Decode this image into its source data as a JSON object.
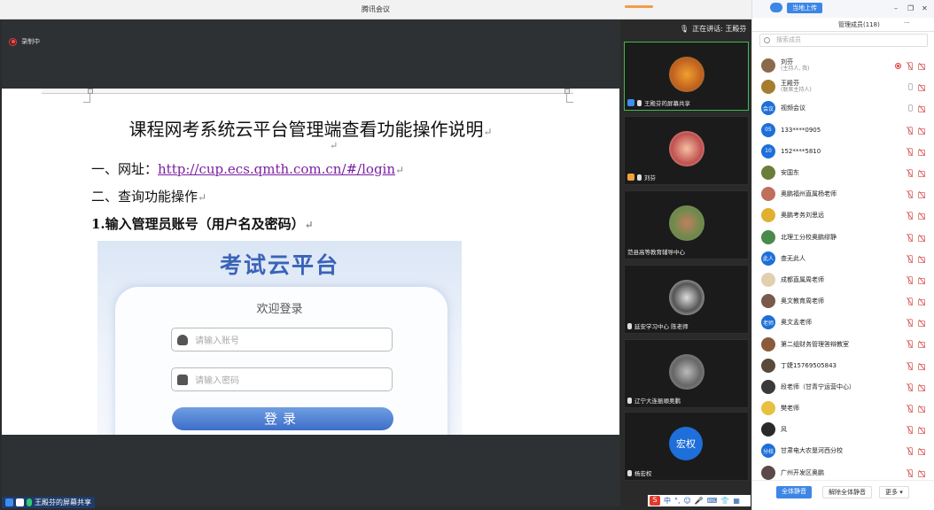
{
  "window": {
    "title": "腾讯会议"
  },
  "recording": {
    "label": "录制中"
  },
  "document": {
    "title": "课程网考系统云平台管理端查看功能操作说明",
    "para_mark": "↵",
    "line1_label": "一、网址：",
    "line1_link": "http://cup.ecs.qmth.com.cn/#/login",
    "line2": "二、查询功能操作",
    "line3": "1.输入管理员账号（用户名及密码）"
  },
  "login_shot": {
    "brand": "考试云平台",
    "welcome": "欢迎登录",
    "account_placeholder": "请输入账号",
    "password_placeholder": "请输入密码",
    "login_button": "登录"
  },
  "share_badge": "王殿芬的屏幕共享",
  "speaking": "正在讲话: 王殿芬",
  "video_tiles": [
    {
      "label": "王殿芬的屏幕共享"
    },
    {
      "label": "刘芬"
    },
    {
      "label": "范县高等教育辅导中心"
    },
    {
      "label": "延安学习中心 陈老师"
    },
    {
      "label": "辽宁大连振顺奥鹏"
    },
    {
      "label": "杨宏权",
      "avatar_text": "宏权"
    }
  ],
  "tray": {
    "text": "中"
  },
  "panel": {
    "upload": "当地上传",
    "tab_members": "管理成员(118)",
    "more": "···",
    "search_placeholder": "搜索成员",
    "members": [
      {
        "name": "刘芬",
        "sub": "(主持人, 我)",
        "color": "#8a6a4a"
      },
      {
        "name": "王殿芬",
        "sub": "(联席主持人)",
        "color": "#a67c2e"
      },
      {
        "name": "视频会议",
        "avatar": "会议",
        "color": "#1e6fd9"
      },
      {
        "name": "133****0905",
        "avatar": "05",
        "color": "#1e6fd9"
      },
      {
        "name": "152****5810",
        "avatar": "10",
        "color": "#1e6fd9"
      },
      {
        "name": "安国东",
        "color": "#6b7d3a"
      },
      {
        "name": "奥鹏福州直属杨老师",
        "color": "#c0705a"
      },
      {
        "name": "奥鹏考务刘思远",
        "color": "#e0b030"
      },
      {
        "name": "北理工分校奥鹏缪静",
        "color": "#4a8a4a"
      },
      {
        "name": "查无此人",
        "avatar": "此人",
        "color": "#1e6fd9"
      },
      {
        "name": "成都直属周老师",
        "color": "#e0d0b0"
      },
      {
        "name": "奥文教育周老师",
        "color": "#7a5a4a"
      },
      {
        "name": "奥文孟老师",
        "avatar": "老师",
        "color": "#1e6fd9"
      },
      {
        "name": "第二组财务管理答辩教室",
        "color": "#8a5a3a"
      },
      {
        "name": "丁婕15769505843",
        "color": "#5a4a3a"
      },
      {
        "name": "段老师（甘青宁运营中心）",
        "color": "#3a3a3a"
      },
      {
        "name": "樊老师",
        "color": "#e8c040"
      },
      {
        "name": "风",
        "color": "#2a2a2a"
      },
      {
        "name": "甘肃电大农垦河西分校",
        "avatar": "分校",
        "color": "#1e6fd9"
      },
      {
        "name": "广州开发区奥鹏",
        "color": "#5a4a4a"
      }
    ],
    "btn_mute_all": "全体静音",
    "btn_unmute_all": "解除全体静音",
    "btn_more": "更多 ▾"
  }
}
